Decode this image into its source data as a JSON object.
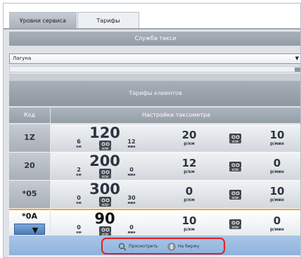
{
  "tabs": [
    {
      "label": "Уровни сервиса"
    },
    {
      "label": "Тарифы"
    }
  ],
  "section": {
    "title": "Служба такси"
  },
  "service_select": {
    "value": "Лагуна"
  },
  "clients_header": "Тарифы клиентов",
  "columns": {
    "code": "Код",
    "settings": "Настройки таксометра"
  },
  "icon_caption": "ИЛИ",
  "rows": [
    {
      "code": "1Z",
      "base_price": "120",
      "incl_km": "6",
      "incl_km_unit": "км",
      "incl_min": "12",
      "incl_min_unit": "мин",
      "rate_km": "20",
      "rate_km_unit": "р/км",
      "rate_min": "10",
      "rate_min_unit": "р/мин"
    },
    {
      "code": "20",
      "base_price": "200",
      "incl_km": "2",
      "incl_km_unit": "км",
      "incl_min": "0",
      "incl_min_unit": "мин",
      "rate_km": "12",
      "rate_km_unit": "р/км",
      "rate_min": "0",
      "rate_min_unit": "р/мин"
    },
    {
      "code": "*05",
      "base_price": "300",
      "incl_km": "0",
      "incl_km_unit": "км",
      "incl_min": "30",
      "incl_min_unit": "мин",
      "rate_km": "0",
      "rate_km_unit": "р/км",
      "rate_min": "10",
      "rate_min_unit": "р/мин"
    },
    {
      "code": "*0A",
      "base_price": "90",
      "incl_km": "0",
      "incl_km_unit": "км",
      "incl_min": "0",
      "incl_min_unit": "мин",
      "rate_km": "10",
      "rate_km_unit": "р/км",
      "rate_min": "0",
      "rate_min_unit": "р/мин"
    }
  ],
  "actions": {
    "preview": "Просмотреть",
    "exchange": "На биржу"
  },
  "colors": {
    "highlight_border": "#e02020",
    "selected_accent": "#e7a92e",
    "action_bar": "#a9c6e8"
  }
}
